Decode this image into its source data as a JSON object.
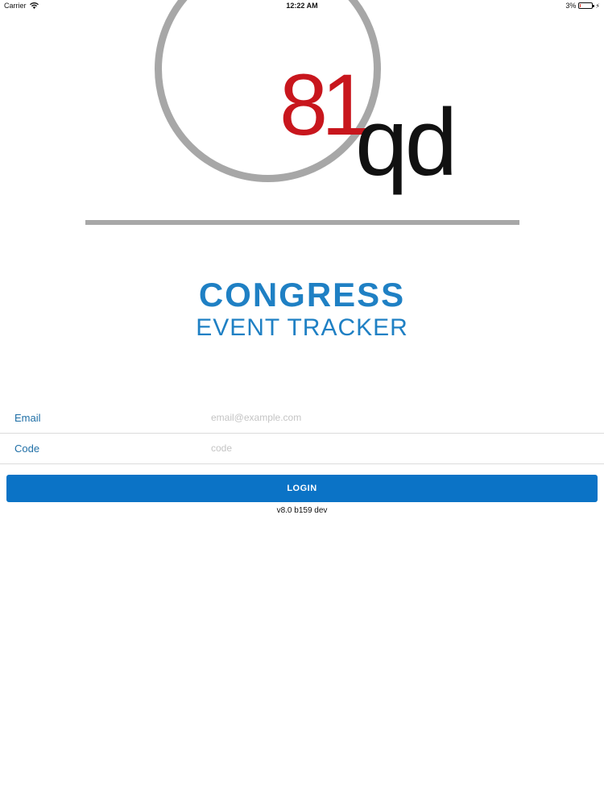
{
  "status_bar": {
    "carrier": "Carrier",
    "time": "12:22 AM",
    "battery": "3%"
  },
  "logo": {
    "number_text": "81",
    "letters_text": "qd",
    "accent_color": "#c8161d",
    "ring_color": "#a7a7a7"
  },
  "app_title": {
    "main": "CONGRESS",
    "sub": "EVENT TRACKER",
    "color": "#1f80c4"
  },
  "form": {
    "email": {
      "label": "Email",
      "placeholder": "email@example.com",
      "value": ""
    },
    "code": {
      "label": "Code",
      "placeholder": "code",
      "value": ""
    }
  },
  "login_button": {
    "label": "LOGIN",
    "color": "#0b73c6"
  },
  "version": "v8.0 b159 dev"
}
